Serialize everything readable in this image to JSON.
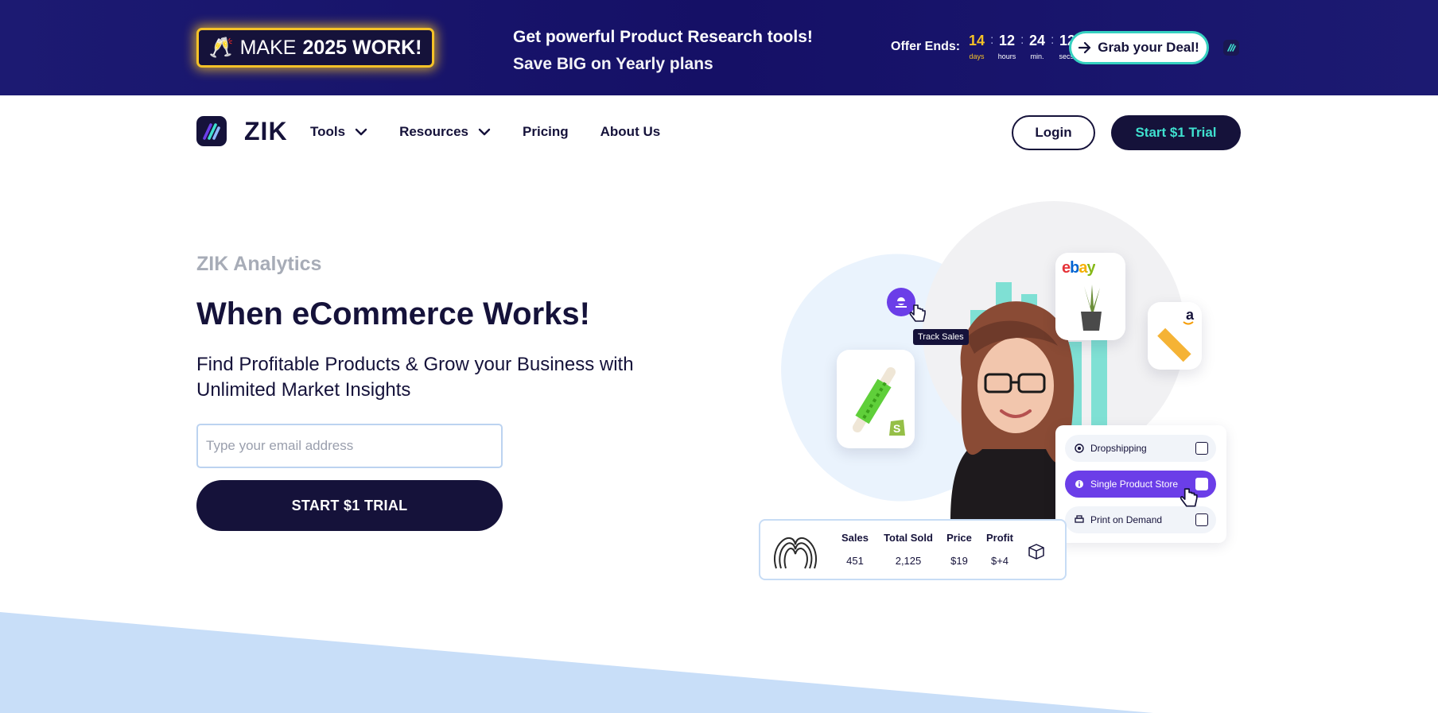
{
  "promo": {
    "badge_emoji": "🥂",
    "badge_prefix": "MAKE",
    "badge_bold": "2025 WORK!",
    "line1": "Get powerful Product Research tools!",
    "line2": "Save BIG on Yearly plans",
    "offer_label": "Offer Ends:",
    "countdown": [
      {
        "value": "14",
        "label": "days"
      },
      {
        "value": "12",
        "label": "hours"
      },
      {
        "value": "24",
        "label": "min."
      },
      {
        "value": "12",
        "label": "secs."
      }
    ],
    "deal_button": "Grab your Deal!"
  },
  "nav": {
    "brand": "ZIK",
    "links": [
      "Tools",
      "Resources",
      "Pricing",
      "About Us"
    ],
    "login": "Login",
    "trial": "Start $1 Trial"
  },
  "hero": {
    "eyebrow": "ZIK Analytics",
    "headline": "When eCommerce Works!",
    "subhead": "Find Profitable Products & Grow your Business with Unlimited Market Insights",
    "email_placeholder": "Type your email address",
    "cta": "START $1 TRIAL"
  },
  "illustration": {
    "tooltip": "Track Sales",
    "ebay_label": "ebay",
    "amazon_label": "a",
    "options": [
      "Dropshipping",
      "Single Product Store",
      "Print on Demand"
    ],
    "active_option": "Single Product Store",
    "stats": [
      {
        "label": "Sales",
        "value": "451"
      },
      {
        "label": "Total Sold",
        "value": "2,125"
      },
      {
        "label": "Price",
        "value": "$19"
      },
      {
        "label": "Profit",
        "value": "$+4"
      }
    ]
  },
  "colors": {
    "banner": "#1c1a72",
    "navy": "#15123a",
    "teal": "#3fe0cf",
    "gold": "#f5c227",
    "purple": "#6b3ee8",
    "wedge": "#c8def8"
  }
}
